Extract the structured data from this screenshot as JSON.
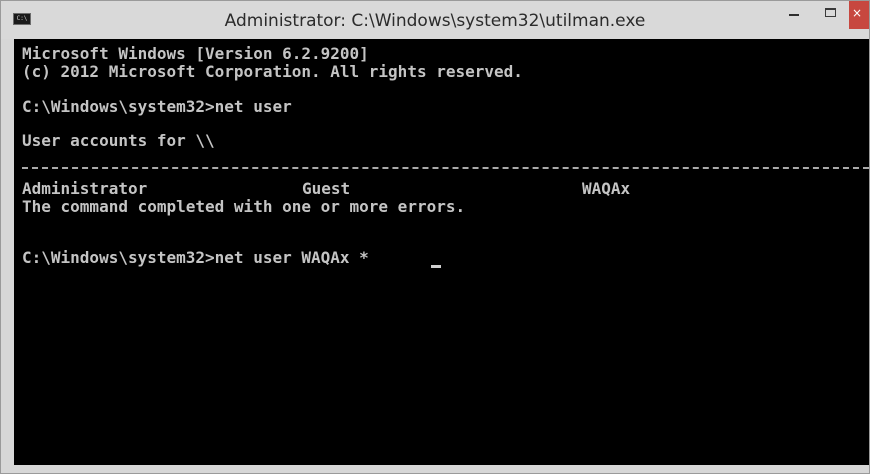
{
  "window": {
    "title": "Administrator: C:\\Windows\\system32\\utilman.exe",
    "icon_label": "C:\\",
    "min_glyph": "",
    "close_glyph": "×"
  },
  "console": {
    "lines": [
      "Microsoft Windows [Version 6.2.9200]",
      "(c) 2012 Microsoft Corporation. All rights reserved.",
      "C:\\Windows\\system32>net user",
      "User accounts for \\\\",
      "The command completed with one or more errors.",
      "C:\\Windows\\system32>net user WAQAx *"
    ],
    "accounts": [
      "Administrator",
      "Guest",
      "WAQAx"
    ]
  },
  "colors": {
    "console_bg": "#000000",
    "console_text": "#c4c4c4",
    "title_bar": "#d9d9d9",
    "close_button": "#c7473f"
  }
}
